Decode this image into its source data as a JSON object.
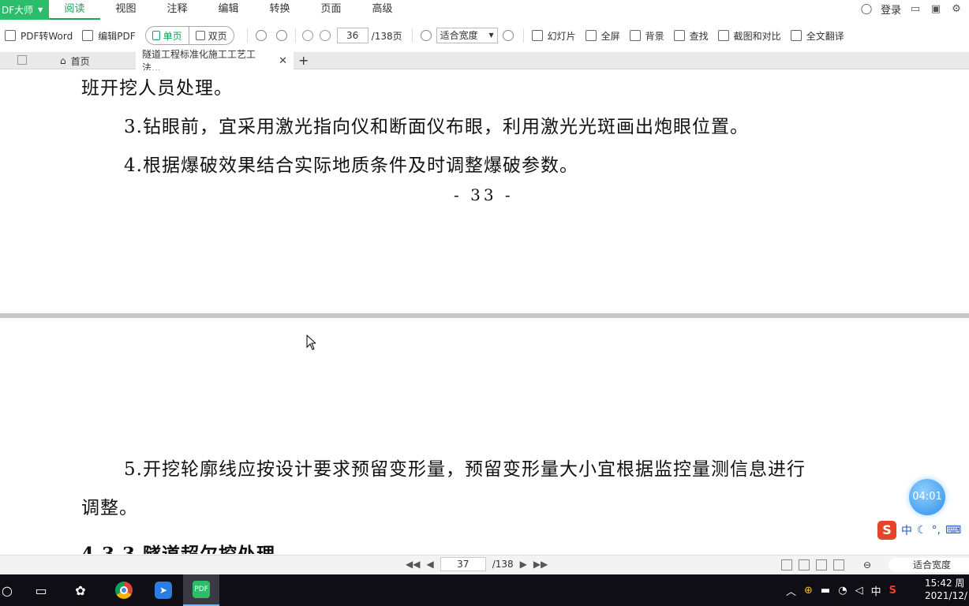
{
  "menubar": {
    "brand": "DF大师",
    "items": [
      {
        "label": "阅读",
        "active": true
      },
      {
        "label": "视图"
      },
      {
        "label": "注释"
      },
      {
        "label": "编辑"
      },
      {
        "label": "转换"
      },
      {
        "label": "页面"
      },
      {
        "label": "高级"
      }
    ],
    "login_label": "登录"
  },
  "toolbar": {
    "pdf_to_word": "PDF转Word",
    "edit_pdf": "编辑PDF",
    "single_page": "单页",
    "double_page": "双页",
    "current_page": "36",
    "total_pages": "/138页",
    "zoom_mode": "适合宽度",
    "slideshow": "幻灯片",
    "fullscreen": "全屏",
    "background": "背景",
    "find": "查找",
    "screenshot_compare": "截图和对比",
    "translate": "全文翻译"
  },
  "tabs": {
    "home": "首页",
    "document": "隧道工程标准化施工工艺工法..."
  },
  "document": {
    "line1": "班开挖人员处理。",
    "line2": "3.钻眼前，宜采用激光指向仪和断面仪布眼，利用激光光斑画出炮眼位置。",
    "line3": "4.根据爆破效果结合实际地质条件及时调整爆破参数。",
    "page_number": "- 33 -",
    "line4": "5.开挖轮廓线应按设计要求预留变形量，预留变形量大小宜根据监控量测信息进行",
    "line5": "调整。",
    "line6": "4.3.3 隧道超欠挖处理"
  },
  "overlay": {
    "timer": "04:01",
    "ime_mode": "中"
  },
  "statusbar": {
    "current_page": "37",
    "total_pages": "/138",
    "zoom_mode": "适合宽度"
  },
  "taskbar": {
    "tray_lang": "中",
    "time": "15:42 周",
    "date": "2021/12/"
  },
  "colors": {
    "accent": "#1aa15b",
    "brand_bg": "#2bbd6a",
    "taskbar_bg": "#0e0e14"
  }
}
